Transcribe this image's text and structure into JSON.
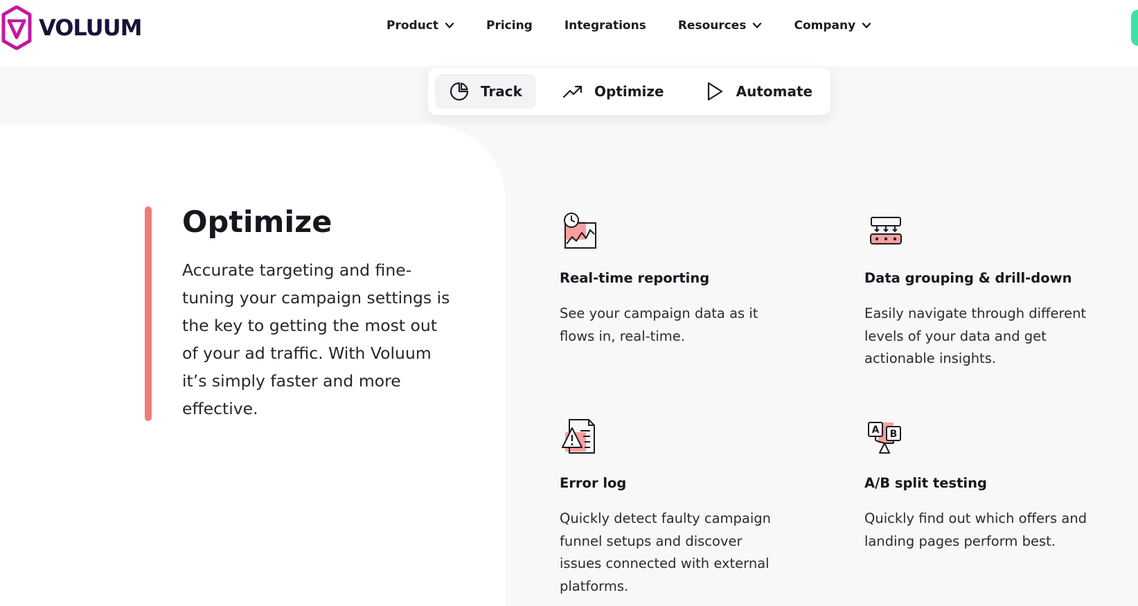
{
  "brand": {
    "name": "VOLUUM",
    "logo_color": "#c4179f",
    "accent": "#f27a7a",
    "cta_color": "#3ce2a2"
  },
  "nav": {
    "items": [
      {
        "label": "Product",
        "has_dropdown": true
      },
      {
        "label": "Pricing",
        "has_dropdown": false
      },
      {
        "label": "Integrations",
        "has_dropdown": false
      },
      {
        "label": "Resources",
        "has_dropdown": true
      },
      {
        "label": "Company",
        "has_dropdown": true
      }
    ]
  },
  "tabs": [
    {
      "label": "Track",
      "icon": "pie-chart-icon",
      "active": true
    },
    {
      "label": "Optimize",
      "icon": "trending-up-icon",
      "active": false
    },
    {
      "label": "Automate",
      "icon": "play-icon",
      "active": false
    }
  ],
  "section": {
    "title": "Optimize",
    "description": "Accurate targeting and fine-tuning your campaign settings is the key to getting the most out of your ad traffic. With Voluum it’s simply faster and more effective."
  },
  "features": [
    {
      "title": "Real-time reporting",
      "description": "See your campaign data as it flows in, real-time.",
      "icon": "realtime-chart-icon"
    },
    {
      "title": "Data grouping & drill-down",
      "description": "Easily navigate through different levels of your data and get actionable insights.",
      "icon": "data-grouping-icon"
    },
    {
      "title": "Error log",
      "description": "Quickly detect faulty campaign funnel setups and discover issues connected with external platforms.",
      "icon": "error-log-icon"
    },
    {
      "title": "A/B split testing",
      "description": "Quickly find out which offers and landing pages perform best.",
      "icon": "ab-testing-icon"
    }
  ]
}
